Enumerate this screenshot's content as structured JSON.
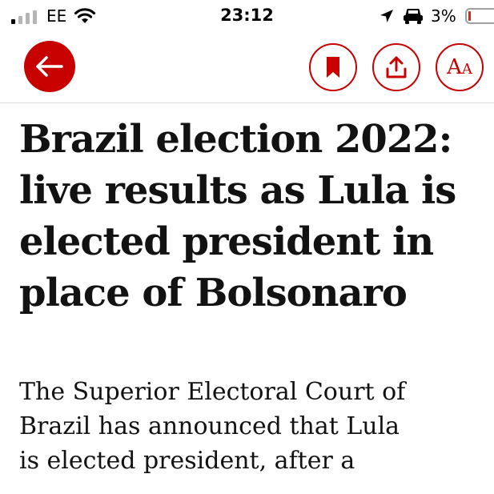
{
  "status_bar": {
    "carrier": "EE",
    "time": "23:12",
    "battery_percent": "3%",
    "icons": [
      "signal-icon",
      "wifi-icon",
      "location-arrow-icon",
      "car-icon",
      "battery-icon"
    ]
  },
  "toolbar": {
    "icons": [
      "back-arrow-icon",
      "bookmark-icon",
      "share-icon",
      "text-size-icon"
    ],
    "text_size_glyph_large": "A",
    "text_size_glyph_small": "A"
  },
  "article": {
    "headline": "Brazil election 2022: live results as Lula is elected president in place of Bolsonaro",
    "standfirst": "The Superior Electoral Court of Brazil has announced that Lula is elected president, after a"
  },
  "colors": {
    "accent": "#c70000",
    "text": "#121212",
    "background": "#ffffff",
    "divider": "#dcdcdc"
  }
}
